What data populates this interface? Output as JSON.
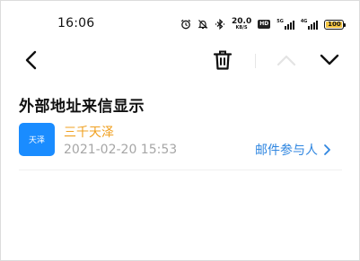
{
  "status_bar": {
    "time": "16:06",
    "net_speed_value": "20.0",
    "net_speed_unit": "KB/S",
    "hd_badge": "HD",
    "sim1_label": "5G",
    "sim2_label": "4G",
    "battery_level": "100",
    "battery_fill_fraction": 1.0
  },
  "mail": {
    "subject": "外部地址来信显示",
    "avatar_text": "天泽",
    "sender": "三千天泽",
    "date": "2021-02-20 15:53",
    "participants_label": "邮件参与人"
  },
  "colors": {
    "accent_blue": "#2f86e0",
    "avatar_blue": "#1a8cff",
    "sender_orange": "#f0a020",
    "muted_gray": "#a6a6a6"
  },
  "icons": [
    "alarm-icon",
    "mute-icon",
    "bluetooth-icon",
    "back-chevron-icon",
    "trash-icon",
    "chevron-up-icon",
    "chevron-down-icon",
    "chevron-right-icon"
  ]
}
